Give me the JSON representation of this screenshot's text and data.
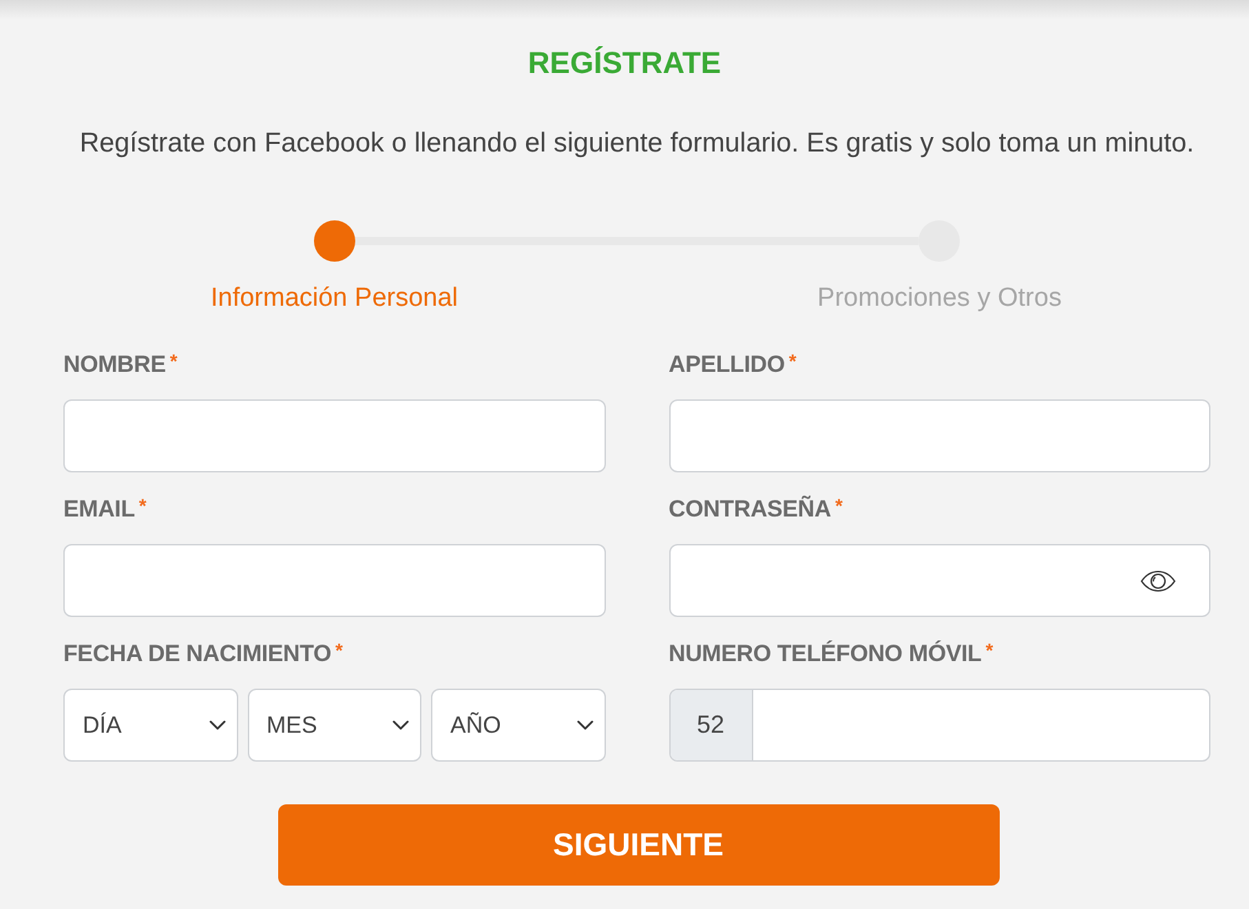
{
  "title": "REGÍSTRATE",
  "subtitle": "Regístrate con Facebook o llenando el siguiente formulario. Es gratis y solo toma un minuto.",
  "steps": [
    {
      "label": "Información Personal",
      "selected": true
    },
    {
      "label": "Promociones y Otros",
      "selected": false
    }
  ],
  "fields": [
    {
      "kind": "text",
      "label": "NOMBRE",
      "required_mark": "*"
    },
    {
      "kind": "text",
      "label": "APELLIDO",
      "required_mark": "*"
    },
    {
      "kind": "text",
      "label": "EMAIL",
      "required_mark": "*"
    },
    {
      "kind": "password",
      "label": "CONTRASEÑA",
      "required_mark": "*"
    },
    {
      "kind": "date",
      "label": "FECHA DE NACIMIENTO",
      "required_mark": "*",
      "selects": [
        {
          "placeholder": "DÍA"
        },
        {
          "placeholder": "MES"
        },
        {
          "placeholder": "AÑO"
        }
      ]
    },
    {
      "kind": "phone",
      "label": "NUMERO TELÉFONO MÓVIL",
      "required_mark": "*",
      "prefix": "52"
    }
  ],
  "submit_button": {
    "label": "SIGUIENTE"
  }
}
